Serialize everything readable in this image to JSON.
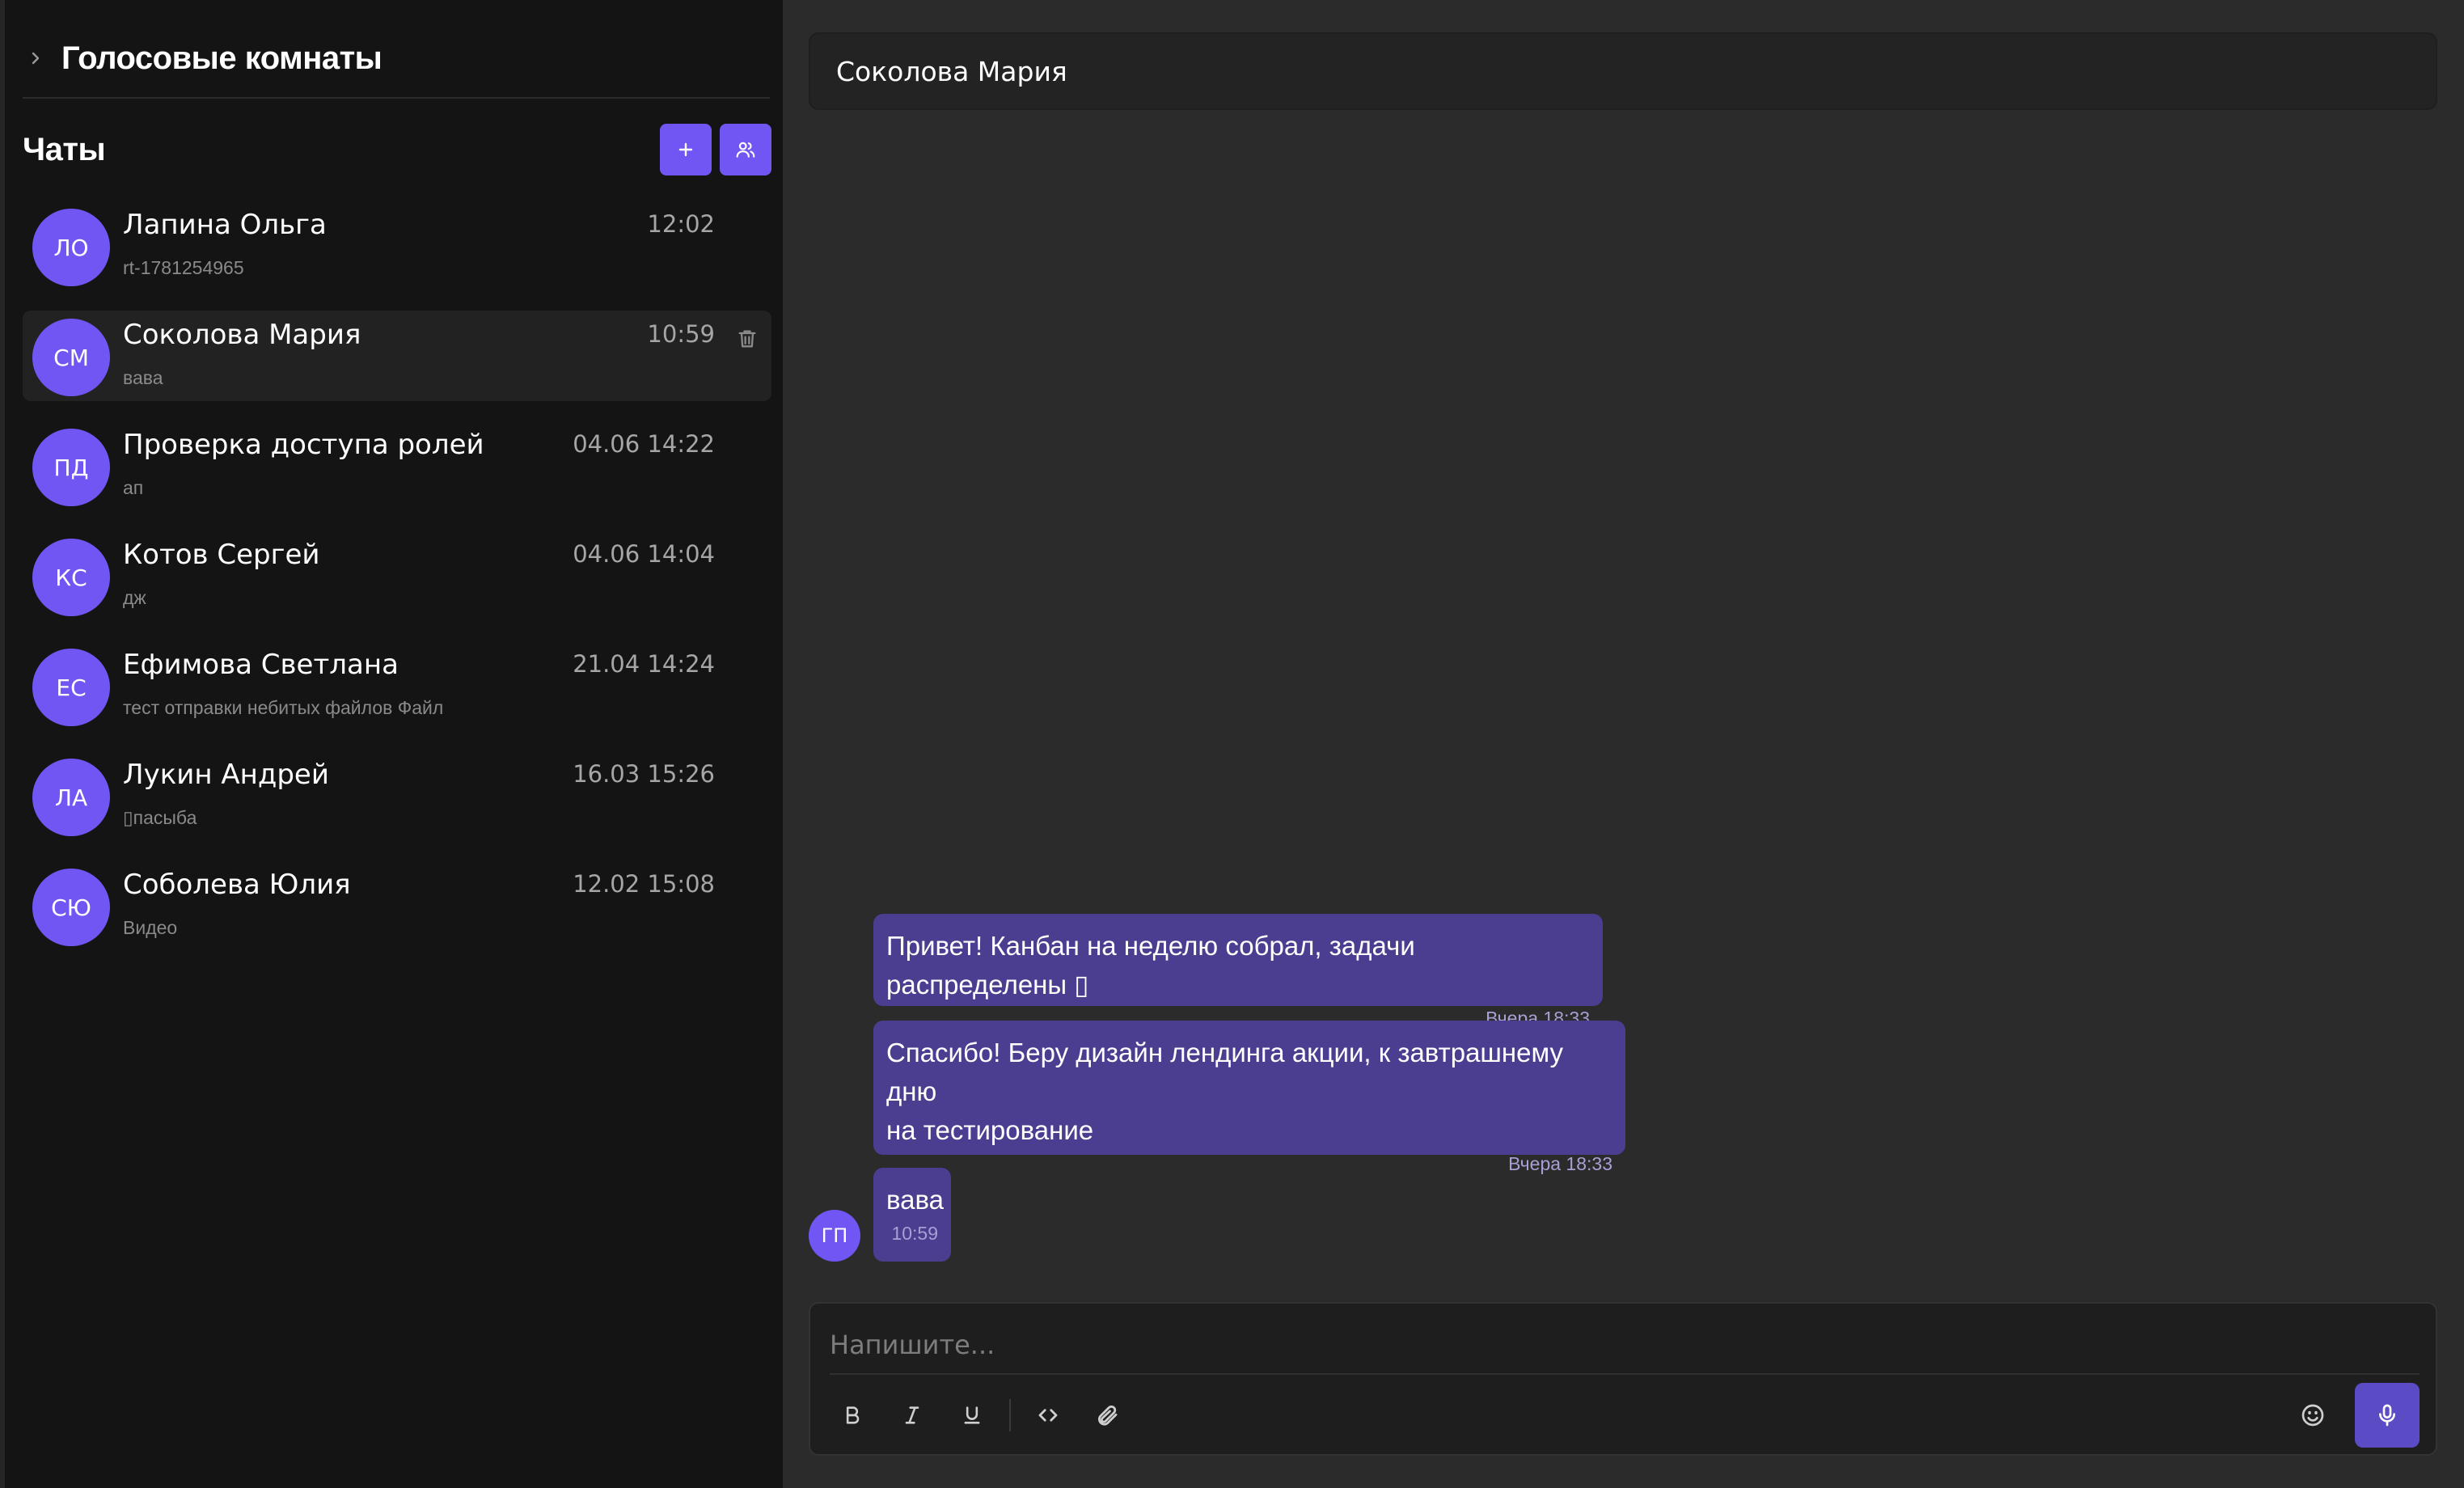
{
  "sidebar": {
    "voice_rooms_title": "Голосовые комнаты",
    "chats_title": "Чаты",
    "chats": [
      {
        "initials": "ЛО",
        "name": "Лапина Ольга",
        "time": "12:02",
        "preview": "rt-1781254965",
        "active": false
      },
      {
        "initials": "СМ",
        "name": "Соколова Мария",
        "time": "10:59",
        "preview": "вава",
        "active": true
      },
      {
        "initials": "ПД",
        "name": "Проверка доступа ролей",
        "time": "04.06 14:22",
        "preview": "ап",
        "active": false
      },
      {
        "initials": "КС",
        "name": "Котов Сергей",
        "time": "04.06 14:04",
        "preview": "дж",
        "active": false
      },
      {
        "initials": "ЕС",
        "name": "Ефимова Светлана",
        "time": "21.04 14:24",
        "preview": "тест отправки небитых файлов Файл",
        "active": false
      },
      {
        "initials": "ЛА",
        "name": "Лукин Андрей",
        "time": "16.03 15:26",
        "preview": "▯пасыба",
        "active": false
      },
      {
        "initials": "СЮ",
        "name": "Соболева Юлия",
        "time": "12.02 15:08",
        "preview": "Видео",
        "active": false
      }
    ]
  },
  "chat": {
    "title": "Соколова Мария",
    "messages": [
      {
        "line1": "Привет! Канбан на неделю собрал, задачи распределены ▯",
        "line2": "",
        "time": "Вчера 18:33"
      },
      {
        "line1": "Спасибо! Беру дизайн лендинга акции, к завтрашнему дню",
        "line2": "на тестирование",
        "time": "Вчера 18:33"
      },
      {
        "line1": "вава",
        "line2": "",
        "time": "10:59"
      }
    ],
    "sender_initials": "ГП"
  },
  "composer": {
    "placeholder": "Напишите..."
  },
  "icons": {
    "add": "plus-icon",
    "group": "users-icon",
    "delete": "trash-icon",
    "bold": "bold-icon",
    "italic": "italic-icon",
    "underline": "underline-icon",
    "code": "code-icon",
    "attach": "paperclip-icon",
    "emoji": "smile-icon",
    "mic": "mic-icon"
  },
  "colors": {
    "accent": "#7256f4",
    "bubble": "#4b3d8f",
    "sidebar_bg": "#141414",
    "main_bg": "#2b2b2b"
  }
}
